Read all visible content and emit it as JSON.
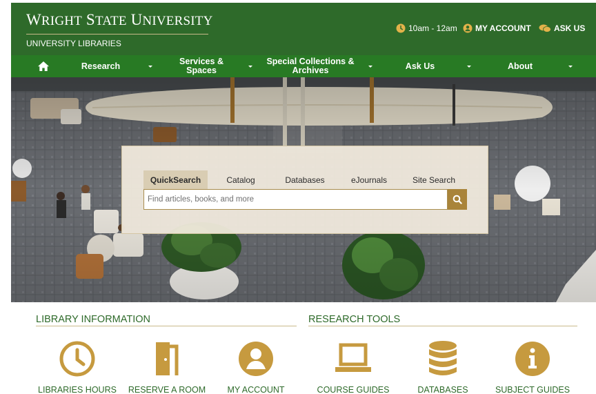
{
  "header": {
    "title": "Wright State University",
    "subtitle": "UNIVERSITY LIBRARIES",
    "hours": "10am - 12am",
    "my_account": "MY ACCOUNT",
    "ask_us": "ASK US"
  },
  "nav": {
    "items": [
      {
        "label": "Research",
        "icon": "chevron-down-icon"
      },
      {
        "label": "Services & Spaces",
        "icon": "chevron-down-icon"
      },
      {
        "label": "Special Collections & Archives",
        "icon": "chevron-down-icon"
      },
      {
        "label": "Ask Us",
        "icon": "chevron-down-icon"
      },
      {
        "label": "About",
        "icon": "chevron-down-icon"
      }
    ]
  },
  "search": {
    "tabs": [
      "QuickSearch",
      "Catalog",
      "Databases",
      "eJournals",
      "Site Search"
    ],
    "active_tab": "QuickSearch",
    "placeholder": "Find articles, books, and more"
  },
  "sections": {
    "library_information": {
      "title": "LIBRARY INFORMATION",
      "links": [
        {
          "label": "LIBRARIES HOURS",
          "icon": "clock-icon"
        },
        {
          "label": "RESERVE A ROOM",
          "icon": "door-icon"
        },
        {
          "label": "MY ACCOUNT",
          "icon": "user-circle-icon"
        }
      ]
    },
    "research_tools": {
      "title": "RESEARCH TOOLS",
      "links": [
        {
          "label": "COURSE GUIDES",
          "icon": "laptop-icon"
        },
        {
          "label": "DATABASES",
          "icon": "database-icon"
        },
        {
          "label": "SUBJECT GUIDES",
          "icon": "info-circle-icon"
        }
      ]
    }
  },
  "colors": {
    "header_green": "#2e6a2a",
    "nav_green": "#287a24",
    "gold": "#c69a3f",
    "search_button_gold": "#a9843a"
  }
}
